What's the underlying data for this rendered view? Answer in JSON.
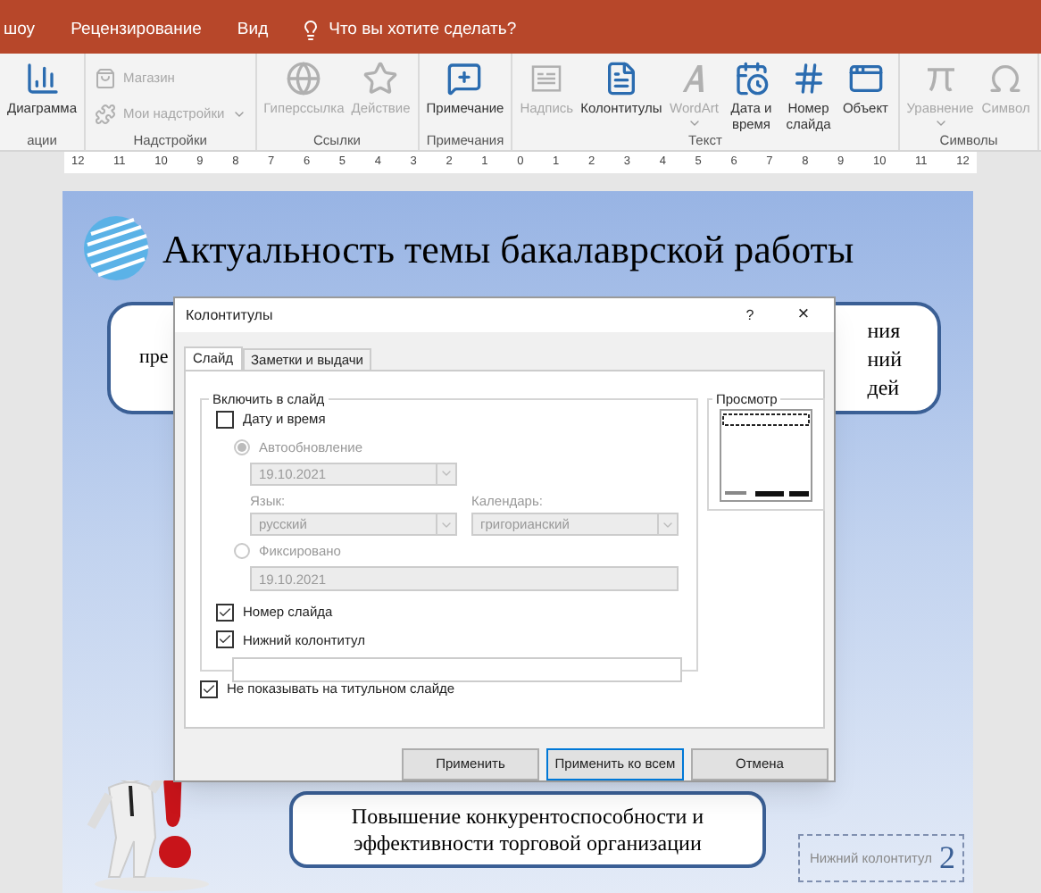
{
  "menu": {
    "tabs": [
      {
        "label": "шоу",
        "selected": false
      },
      {
        "label": "Рецензирование",
        "selected": false
      },
      {
        "label": "Вид",
        "selected": false
      }
    ],
    "search": "Что вы хотите сделать?"
  },
  "ribbon": {
    "groups": [
      {
        "label": "ации",
        "items": [
          {
            "kind": "large",
            "label": "Диаграмма",
            "disabled": false,
            "has_menu": false
          }
        ]
      },
      {
        "label": "Надстройки",
        "items": [
          {
            "kind": "small",
            "label": "Магазин",
            "disabled": true,
            "has_menu": false
          },
          {
            "kind": "small",
            "label": "Мои надстройки",
            "disabled": true,
            "has_menu": true
          }
        ]
      },
      {
        "label": "Ссылки",
        "items": [
          {
            "kind": "large",
            "label": "Гиперссылка",
            "disabled": true,
            "has_menu": false
          },
          {
            "kind": "large",
            "label": "Действие",
            "disabled": true,
            "has_menu": false
          }
        ]
      },
      {
        "label": "Примечания",
        "items": [
          {
            "kind": "large",
            "label": "Примечание",
            "disabled": false,
            "has_menu": false
          }
        ]
      },
      {
        "label": "Текст",
        "items": [
          {
            "kind": "large",
            "label": "Надпись",
            "disabled": true,
            "has_menu": false
          },
          {
            "kind": "large",
            "label": "Колонтитулы",
            "disabled": false,
            "has_menu": false
          },
          {
            "kind": "large",
            "label": "WordArt",
            "disabled": true,
            "has_menu": true
          },
          {
            "kind": "large",
            "label": "Дата и время",
            "disabled": false,
            "has_menu": false
          },
          {
            "kind": "large",
            "label": "Номер слайда",
            "disabled": false,
            "has_menu": false
          },
          {
            "kind": "large",
            "label": "Объект",
            "disabled": false,
            "has_menu": false
          }
        ]
      },
      {
        "label": "Символы",
        "items": [
          {
            "kind": "large",
            "label": "Уравнение",
            "disabled": true,
            "has_menu": true
          },
          {
            "kind": "large",
            "label": "Символ",
            "disabled": true,
            "has_menu": false
          }
        ]
      }
    ]
  },
  "ruler": [
    "12",
    "11",
    "10",
    "9",
    "8",
    "7",
    "6",
    "5",
    "4",
    "3",
    "2",
    "1",
    "0",
    "1",
    "2",
    "3",
    "4",
    "5",
    "6",
    "7",
    "8",
    "9",
    "10",
    "11",
    "12"
  ],
  "slide": {
    "title": "Актуальность темы бакалаврской работы",
    "top_box": {
      "left": [
        "пре"
      ],
      "right": [
        "ния",
        "ний",
        "дей"
      ]
    },
    "bottom_box": [
      "Повышение конкурентоспособности и",
      "эффективности торговой организации"
    ],
    "footer": "Нижний колонтитул",
    "number": "2"
  },
  "dialog": {
    "title": "Колонтитулы",
    "help": "?",
    "close": "×",
    "tabs": [
      {
        "label": "Слайд",
        "selected": true
      },
      {
        "label": "Заметки и выдачи",
        "selected": false
      }
    ],
    "group_label": "Включить в слайд",
    "date_time": {
      "label": "Дату и время",
      "checked": false
    },
    "auto_update": {
      "label": "Автообновление",
      "selected": true
    },
    "auto_date": "19.10.2021",
    "language_label": "Язык:",
    "language": "русский",
    "calendar_label": "Календарь:",
    "calendar": "григорианский",
    "fixed": {
      "label": "Фиксировано",
      "selected": false
    },
    "fixed_date": "19.10.2021",
    "slide_number": {
      "label": "Номер слайда",
      "checked": true
    },
    "footer": {
      "label": "Нижний колонтитул",
      "checked": true
    },
    "dont_show": {
      "label": "Не показывать на титульном слайде",
      "checked": true
    },
    "preview_label": "Просмотр",
    "buttons": [
      {
        "label": "Применить",
        "default": false
      },
      {
        "label": "Применить ко всем",
        "default": true
      },
      {
        "label": "Отмена",
        "default": false
      }
    ]
  }
}
